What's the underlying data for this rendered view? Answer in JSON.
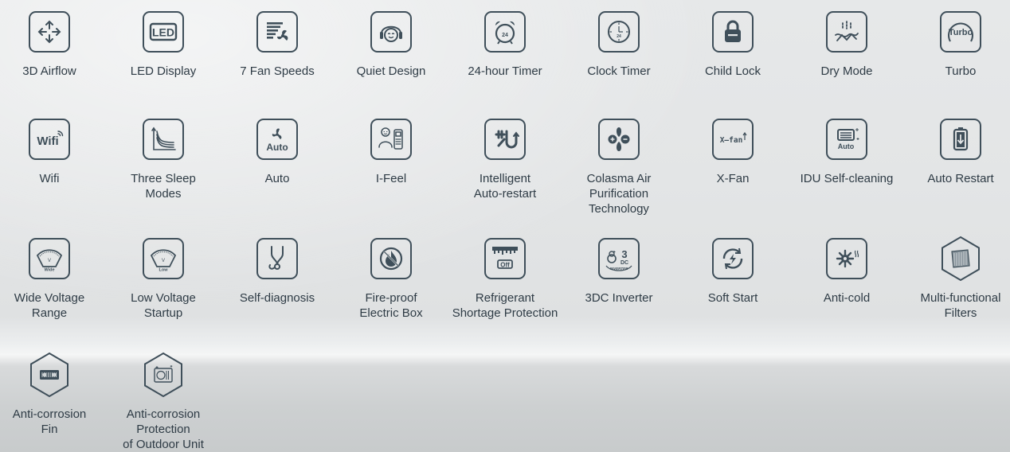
{
  "features": [
    {
      "lines": [
        "3D Airflow"
      ]
    },
    {
      "lines": [
        "LED Display"
      ],
      "badge_text": "LED"
    },
    {
      "lines": [
        "7 Fan Speeds"
      ]
    },
    {
      "lines": [
        "Quiet Design"
      ]
    },
    {
      "lines": [
        "24-hour Timer"
      ],
      "badge_text": "24"
    },
    {
      "lines": [
        "Clock Timer"
      ],
      "badge_text": "24"
    },
    {
      "lines": [
        "Child Lock"
      ]
    },
    {
      "lines": [
        "Dry Mode"
      ]
    },
    {
      "lines": [
        "Turbo"
      ],
      "badge_text": "Turbo"
    },
    {
      "lines": [
        "Wifi"
      ],
      "badge_text": "Wifi"
    },
    {
      "lines": [
        "Three Sleep",
        "Modes"
      ]
    },
    {
      "lines": [
        "Auto"
      ],
      "badge_text": "Auto"
    },
    {
      "lines": [
        "I-Feel"
      ]
    },
    {
      "lines": [
        "Intelligent",
        "Auto-restart"
      ]
    },
    {
      "lines": [
        "Colasma Air",
        "Purification",
        "Technology"
      ]
    },
    {
      "lines": [
        "X-Fan"
      ],
      "badge_text": "X–fan"
    },
    {
      "lines": [
        "IDU Self-cleaning"
      ],
      "badge_text": "Auto"
    },
    {
      "lines": [
        "Auto Restart"
      ]
    },
    {
      "lines": [
        "Wide Voltage",
        "Range"
      ],
      "badge_text": "Wide"
    },
    {
      "lines": [
        "Low Voltage",
        "Startup"
      ],
      "badge_text": "Low"
    },
    {
      "lines": [
        "Self-diagnosis"
      ]
    },
    {
      "lines": [
        "Fire-proof",
        "Electric Box"
      ]
    },
    {
      "lines": [
        "Refrigerant",
        "Shortage Protection"
      ],
      "badge_text": "Off"
    },
    {
      "lines": [
        "3DC Inverter"
      ],
      "badge_text": "3",
      "badge_text2": "DC",
      "badge_text3": "INVERTER"
    },
    {
      "lines": [
        "Soft Start"
      ]
    },
    {
      "lines": [
        "Anti-cold"
      ]
    },
    {
      "lines": [
        "Multi-functional",
        "Filters"
      ]
    },
    {
      "lines": [
        "Anti-corrosion",
        "Fin"
      ]
    },
    {
      "lines": [
        "Anti-corrosion",
        "Protection",
        "of Outdoor Unit"
      ]
    }
  ],
  "colors": {
    "icon_stroke": "#3f4f5a",
    "label_text": "#2e3b45"
  },
  "icons": [
    "airflow-3d-icon",
    "led-display-icon",
    "fan-speeds-icon",
    "quiet-design-icon",
    "alarm-timer-icon",
    "clock-timer-icon",
    "child-lock-icon",
    "dry-mode-icon",
    "turbo-icon",
    "wifi-icon",
    "sleep-modes-icon",
    "auto-icon",
    "i-feel-icon",
    "intelligent-restart-icon",
    "colasma-icon",
    "x-fan-icon",
    "idu-self-cleaning-icon",
    "auto-restart-icon",
    "wide-voltage-icon",
    "low-voltage-icon",
    "self-diagnosis-icon",
    "fireproof-box-icon",
    "refrigerant-shortage-icon",
    "inverter-3dc-icon",
    "soft-start-icon",
    "anti-cold-icon",
    "multi-filter-icon",
    "anti-corrosion-fin-icon",
    "anti-corrosion-outdoor-icon"
  ]
}
